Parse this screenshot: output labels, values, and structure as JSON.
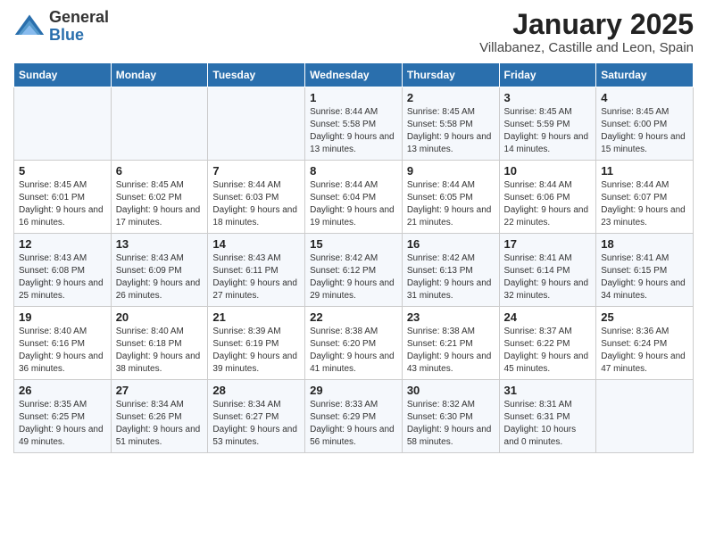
{
  "logo": {
    "general": "General",
    "blue": "Blue"
  },
  "title": "January 2025",
  "subtitle": "Villabanez, Castille and Leon, Spain",
  "weekdays": [
    "Sunday",
    "Monday",
    "Tuesday",
    "Wednesday",
    "Thursday",
    "Friday",
    "Saturday"
  ],
  "weeks": [
    [
      null,
      null,
      null,
      {
        "day": "1",
        "sunrise": "Sunrise: 8:44 AM",
        "sunset": "Sunset: 5:58 PM",
        "daylight": "Daylight: 9 hours and 13 minutes."
      },
      {
        "day": "2",
        "sunrise": "Sunrise: 8:45 AM",
        "sunset": "Sunset: 5:58 PM",
        "daylight": "Daylight: 9 hours and 13 minutes."
      },
      {
        "day": "3",
        "sunrise": "Sunrise: 8:45 AM",
        "sunset": "Sunset: 5:59 PM",
        "daylight": "Daylight: 9 hours and 14 minutes."
      },
      {
        "day": "4",
        "sunrise": "Sunrise: 8:45 AM",
        "sunset": "Sunset: 6:00 PM",
        "daylight": "Daylight: 9 hours and 15 minutes."
      }
    ],
    [
      {
        "day": "5",
        "sunrise": "Sunrise: 8:45 AM",
        "sunset": "Sunset: 6:01 PM",
        "daylight": "Daylight: 9 hours and 16 minutes."
      },
      {
        "day": "6",
        "sunrise": "Sunrise: 8:45 AM",
        "sunset": "Sunset: 6:02 PM",
        "daylight": "Daylight: 9 hours and 17 minutes."
      },
      {
        "day": "7",
        "sunrise": "Sunrise: 8:44 AM",
        "sunset": "Sunset: 6:03 PM",
        "daylight": "Daylight: 9 hours and 18 minutes."
      },
      {
        "day": "8",
        "sunrise": "Sunrise: 8:44 AM",
        "sunset": "Sunset: 6:04 PM",
        "daylight": "Daylight: 9 hours and 19 minutes."
      },
      {
        "day": "9",
        "sunrise": "Sunrise: 8:44 AM",
        "sunset": "Sunset: 6:05 PM",
        "daylight": "Daylight: 9 hours and 21 minutes."
      },
      {
        "day": "10",
        "sunrise": "Sunrise: 8:44 AM",
        "sunset": "Sunset: 6:06 PM",
        "daylight": "Daylight: 9 hours and 22 minutes."
      },
      {
        "day": "11",
        "sunrise": "Sunrise: 8:44 AM",
        "sunset": "Sunset: 6:07 PM",
        "daylight": "Daylight: 9 hours and 23 minutes."
      }
    ],
    [
      {
        "day": "12",
        "sunrise": "Sunrise: 8:43 AM",
        "sunset": "Sunset: 6:08 PM",
        "daylight": "Daylight: 9 hours and 25 minutes."
      },
      {
        "day": "13",
        "sunrise": "Sunrise: 8:43 AM",
        "sunset": "Sunset: 6:09 PM",
        "daylight": "Daylight: 9 hours and 26 minutes."
      },
      {
        "day": "14",
        "sunrise": "Sunrise: 8:43 AM",
        "sunset": "Sunset: 6:11 PM",
        "daylight": "Daylight: 9 hours and 27 minutes."
      },
      {
        "day": "15",
        "sunrise": "Sunrise: 8:42 AM",
        "sunset": "Sunset: 6:12 PM",
        "daylight": "Daylight: 9 hours and 29 minutes."
      },
      {
        "day": "16",
        "sunrise": "Sunrise: 8:42 AM",
        "sunset": "Sunset: 6:13 PM",
        "daylight": "Daylight: 9 hours and 31 minutes."
      },
      {
        "day": "17",
        "sunrise": "Sunrise: 8:41 AM",
        "sunset": "Sunset: 6:14 PM",
        "daylight": "Daylight: 9 hours and 32 minutes."
      },
      {
        "day": "18",
        "sunrise": "Sunrise: 8:41 AM",
        "sunset": "Sunset: 6:15 PM",
        "daylight": "Daylight: 9 hours and 34 minutes."
      }
    ],
    [
      {
        "day": "19",
        "sunrise": "Sunrise: 8:40 AM",
        "sunset": "Sunset: 6:16 PM",
        "daylight": "Daylight: 9 hours and 36 minutes."
      },
      {
        "day": "20",
        "sunrise": "Sunrise: 8:40 AM",
        "sunset": "Sunset: 6:18 PM",
        "daylight": "Daylight: 9 hours and 38 minutes."
      },
      {
        "day": "21",
        "sunrise": "Sunrise: 8:39 AM",
        "sunset": "Sunset: 6:19 PM",
        "daylight": "Daylight: 9 hours and 39 minutes."
      },
      {
        "day": "22",
        "sunrise": "Sunrise: 8:38 AM",
        "sunset": "Sunset: 6:20 PM",
        "daylight": "Daylight: 9 hours and 41 minutes."
      },
      {
        "day": "23",
        "sunrise": "Sunrise: 8:38 AM",
        "sunset": "Sunset: 6:21 PM",
        "daylight": "Daylight: 9 hours and 43 minutes."
      },
      {
        "day": "24",
        "sunrise": "Sunrise: 8:37 AM",
        "sunset": "Sunset: 6:22 PM",
        "daylight": "Daylight: 9 hours and 45 minutes."
      },
      {
        "day": "25",
        "sunrise": "Sunrise: 8:36 AM",
        "sunset": "Sunset: 6:24 PM",
        "daylight": "Daylight: 9 hours and 47 minutes."
      }
    ],
    [
      {
        "day": "26",
        "sunrise": "Sunrise: 8:35 AM",
        "sunset": "Sunset: 6:25 PM",
        "daylight": "Daylight: 9 hours and 49 minutes."
      },
      {
        "day": "27",
        "sunrise": "Sunrise: 8:34 AM",
        "sunset": "Sunset: 6:26 PM",
        "daylight": "Daylight: 9 hours and 51 minutes."
      },
      {
        "day": "28",
        "sunrise": "Sunrise: 8:34 AM",
        "sunset": "Sunset: 6:27 PM",
        "daylight": "Daylight: 9 hours and 53 minutes."
      },
      {
        "day": "29",
        "sunrise": "Sunrise: 8:33 AM",
        "sunset": "Sunset: 6:29 PM",
        "daylight": "Daylight: 9 hours and 56 minutes."
      },
      {
        "day": "30",
        "sunrise": "Sunrise: 8:32 AM",
        "sunset": "Sunset: 6:30 PM",
        "daylight": "Daylight: 9 hours and 58 minutes."
      },
      {
        "day": "31",
        "sunrise": "Sunrise: 8:31 AM",
        "sunset": "Sunset: 6:31 PM",
        "daylight": "Daylight: 10 hours and 0 minutes."
      },
      null
    ]
  ]
}
